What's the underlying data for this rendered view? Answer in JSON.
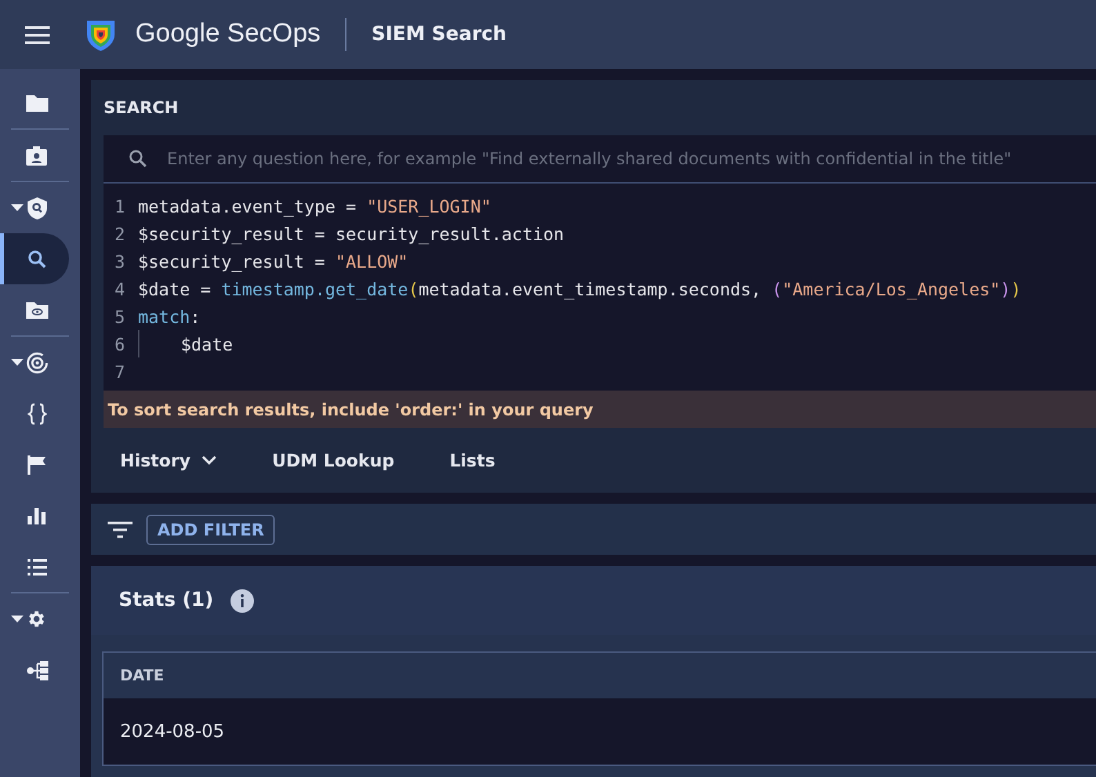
{
  "header": {
    "brand": "Google SecOps",
    "page_title": "SIEM Search"
  },
  "sidebar": {
    "groups": [
      {
        "items": [
          {
            "expandable": false,
            "selected": false
          }
        ]
      },
      {
        "items": [
          {
            "expandable": false,
            "selected": false
          }
        ]
      },
      {
        "items": [
          {
            "expandable": true,
            "selected": false
          },
          {
            "expandable": false,
            "selected": true
          },
          {
            "expandable": false,
            "selected": false
          }
        ]
      },
      {
        "items": [
          {
            "expandable": true,
            "selected": false
          },
          {
            "expandable": false,
            "selected": false
          },
          {
            "expandable": false,
            "selected": false
          },
          {
            "expandable": false,
            "selected": false
          },
          {
            "expandable": false,
            "selected": false
          }
        ]
      },
      {
        "items": [
          {
            "expandable": true,
            "selected": false
          },
          {
            "expandable": false,
            "selected": false
          }
        ]
      }
    ]
  },
  "search": {
    "title": "SEARCH",
    "placeholder": "Enter any question here, for example \"Find externally shared documents with confidential in the title\"",
    "code_lines": [
      {
        "number": "1",
        "tokens": [
          {
            "kind": "plain",
            "text": "metadata.event_type = "
          },
          {
            "kind": "string",
            "text": "\"USER_LOGIN\""
          }
        ]
      },
      {
        "number": "2",
        "tokens": [
          {
            "kind": "plain",
            "text": "$security_result = security_result.action"
          }
        ]
      },
      {
        "number": "3",
        "tokens": [
          {
            "kind": "plain",
            "text": "$security_result = "
          },
          {
            "kind": "string",
            "text": "\"ALLOW\""
          }
        ]
      },
      {
        "number": "4",
        "tokens": [
          {
            "kind": "plain",
            "text": "$date = "
          },
          {
            "kind": "function",
            "text": "timestamp.get_date"
          },
          {
            "kind": "bracket",
            "text": "("
          },
          {
            "kind": "plain",
            "text": "metadata.event_timestamp.seconds, "
          },
          {
            "kind": "bracket2",
            "text": "("
          },
          {
            "kind": "string",
            "text": "\"America/Los_Angeles\""
          },
          {
            "kind": "bracket2",
            "text": ")"
          },
          {
            "kind": "bracket",
            "text": ")"
          }
        ]
      },
      {
        "number": "5",
        "tokens": [
          {
            "kind": "keyword",
            "text": "match"
          },
          {
            "kind": "plain",
            "text": ":"
          }
        ]
      },
      {
        "number": "6",
        "tokens": [
          {
            "kind": "indent"
          },
          {
            "kind": "plain",
            "text": "$date"
          }
        ]
      },
      {
        "number": "7"
      }
    ],
    "hint": "To sort search results, include 'order:' in your query",
    "tabs": [
      {
        "label": "History",
        "dropdown": true
      },
      {
        "label": "UDM Lookup",
        "dropdown": false
      },
      {
        "label": "Lists",
        "dropdown": false
      }
    ]
  },
  "filter": {
    "button": "ADD FILTER"
  },
  "stats": {
    "title": "Stats (1)",
    "columns": [
      "DATE"
    ],
    "rows": [
      [
        "2024-08-05"
      ]
    ]
  }
}
